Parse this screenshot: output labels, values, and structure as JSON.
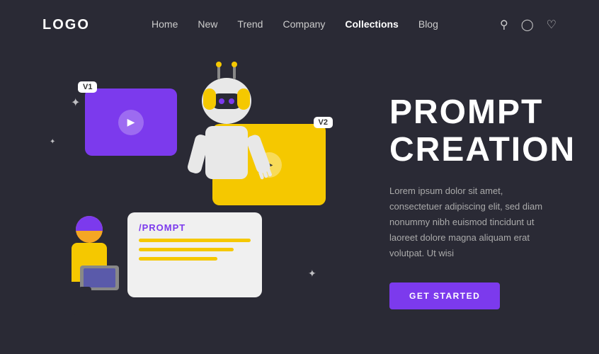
{
  "nav": {
    "logo": "LOGO",
    "links": [
      {
        "label": "Home",
        "active": false
      },
      {
        "label": "New",
        "active": false
      },
      {
        "label": "Trend",
        "active": false
      },
      {
        "label": "Company",
        "active": false
      },
      {
        "label": "Collections",
        "active": true
      },
      {
        "label": "Blog",
        "active": false
      }
    ],
    "icons": [
      "search",
      "user",
      "heart"
    ]
  },
  "hero": {
    "title_line1": "PROMPT",
    "title_line2": "CREATION",
    "description": "Lorem ipsum dolor sit amet, consectetuer adipiscing elit, sed diam nonummy nibh euismod tincidunt ut laoreet dolore magna aliquam erat volutpat. Ut wisi",
    "cta_label": "GET STARTED"
  },
  "illustration": {
    "card_v1_badge": "V1",
    "card_v2_badge": "V2",
    "prompt_label": "/PROMPT"
  },
  "colors": {
    "bg": "#2a2a35",
    "purple": "#7c3aed",
    "yellow": "#f5c800",
    "white": "#ffffff",
    "muted": "#aaaaaa"
  }
}
